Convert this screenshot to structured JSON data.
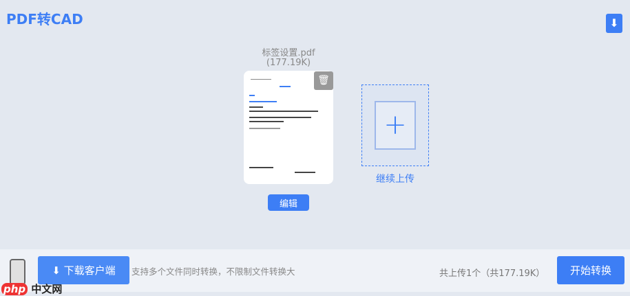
{
  "app": {
    "title": "PDF转CAD"
  },
  "file": {
    "name": "标签设置.pdf",
    "size": "(177.19K)",
    "edit_label": "编辑"
  },
  "upload": {
    "label": "继续上传"
  },
  "footer": {
    "download_label": "下载客户端",
    "tip": "支持多个文件同时转换，不限制文件转换大",
    "count": "共上传1个（共177.19K）",
    "start_label": "开始转换"
  },
  "watermark": {
    "text": "php中文网"
  }
}
